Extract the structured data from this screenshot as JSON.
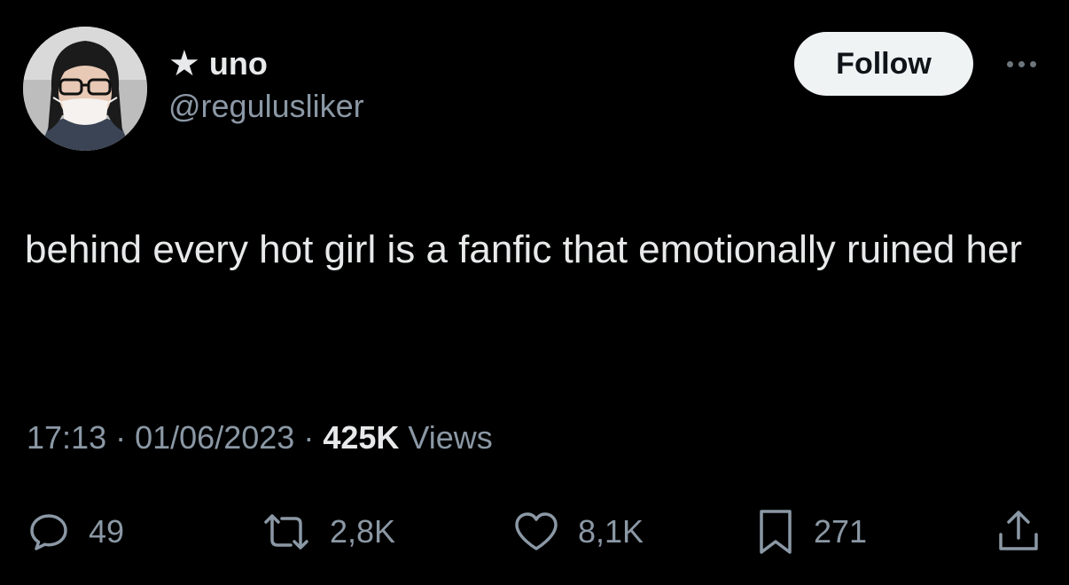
{
  "user": {
    "star": "★",
    "display_name": "uno",
    "handle": "@regulusliker",
    "avatar": "avatar-photo"
  },
  "header": {
    "follow_label": "Follow",
    "more_icon": "more-icon"
  },
  "tweet": {
    "text": "behind every hot girl is a fanfic that emotionally ruined her"
  },
  "meta": {
    "time": "17:13",
    "separator": "·",
    "date": "01/06/2023",
    "views_count": "425K",
    "views_label": "Views"
  },
  "actions": {
    "replies": {
      "icon": "reply-icon",
      "count": "49"
    },
    "reposts": {
      "icon": "repost-icon",
      "count": "2,8K"
    },
    "likes": {
      "icon": "heart-icon",
      "count": "8,1K"
    },
    "bookmarks": {
      "icon": "bookmark-icon",
      "count": "271"
    },
    "share": {
      "icon": "share-icon"
    }
  },
  "colors": {
    "background": "#000000",
    "text": "#e7e9ea",
    "muted": "#8b98a5",
    "button_bg": "#eff3f4",
    "button_text": "#0f1419"
  }
}
